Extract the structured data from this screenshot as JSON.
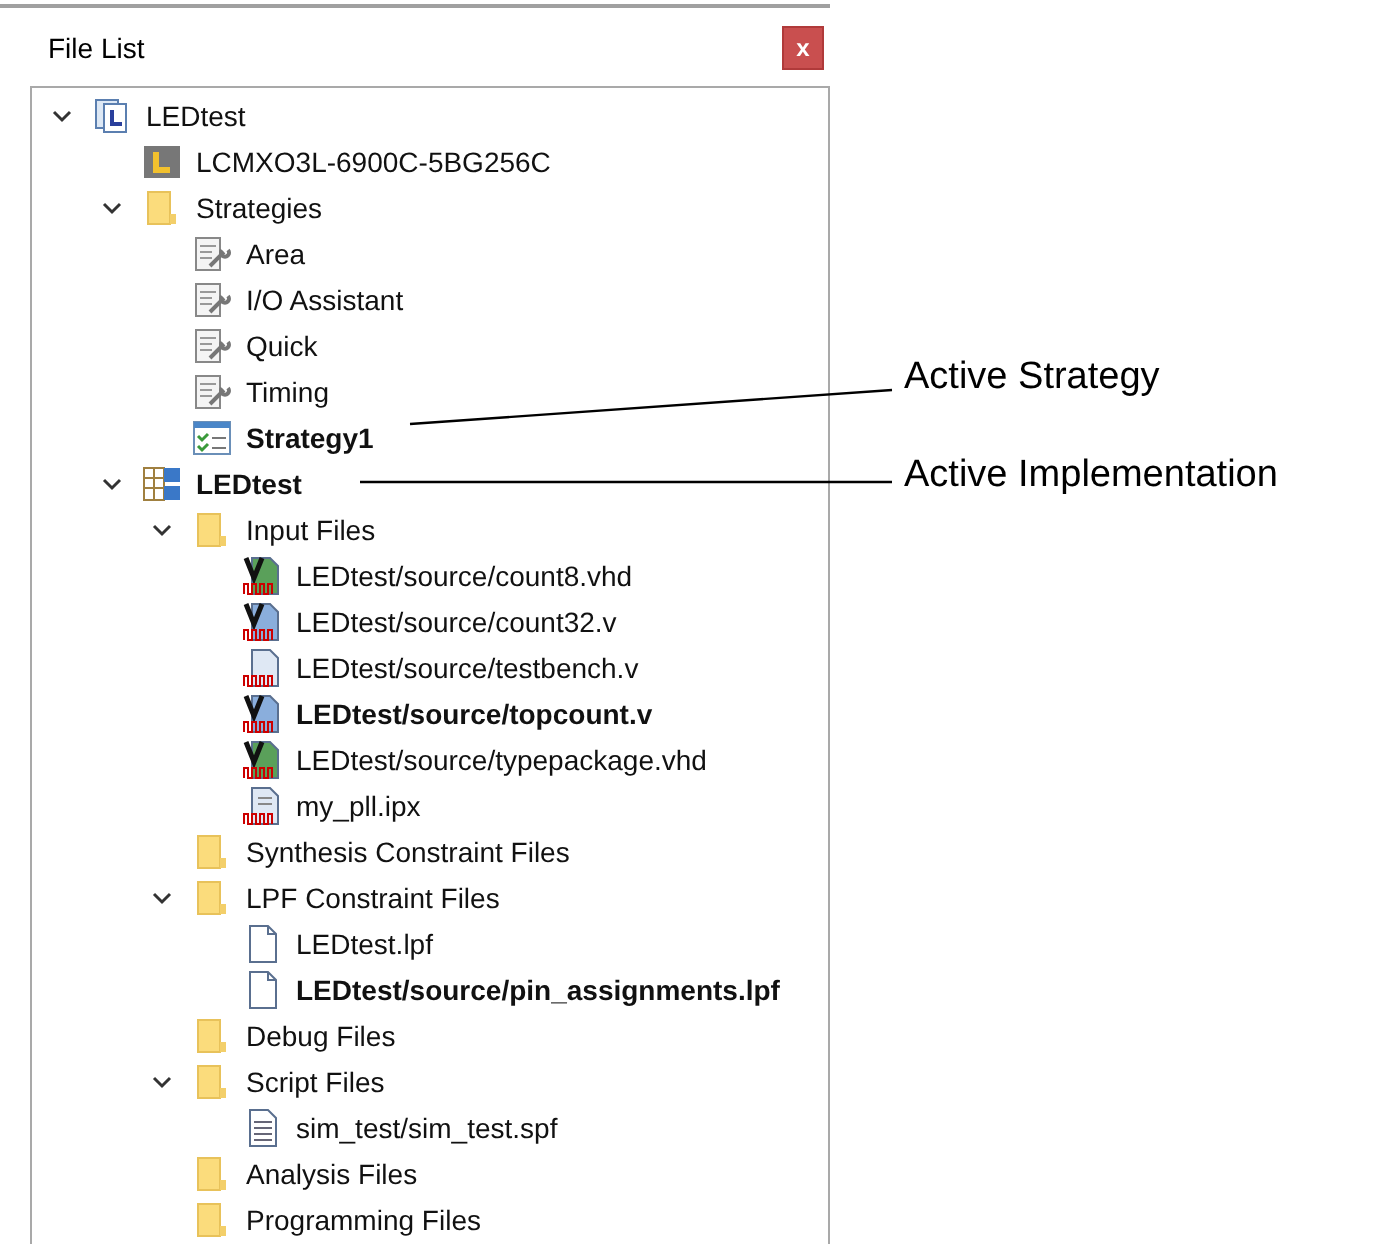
{
  "panel": {
    "title": "File List",
    "close_label": "x"
  },
  "tree": [
    {
      "label": "LEDtest",
      "kind": "project",
      "active": false,
      "expanded": true,
      "children": [
        {
          "label": "LCMXO3L-6900C-5BG256C",
          "kind": "device",
          "active": false
        },
        {
          "label": "Strategies",
          "kind": "folder",
          "active": false,
          "expanded": true,
          "children": [
            {
              "label": "Area",
              "kind": "strategy",
              "active": false
            },
            {
              "label": "I/O Assistant",
              "kind": "strategy",
              "active": false
            },
            {
              "label": "Quick",
              "kind": "strategy",
              "active": false
            },
            {
              "label": "Timing",
              "kind": "strategy",
              "active": false
            },
            {
              "label": "Strategy1",
              "kind": "checklist",
              "active": true
            }
          ]
        },
        {
          "label": "LEDtest",
          "kind": "implementation",
          "active": true,
          "expanded": true,
          "children": [
            {
              "label": "Input Files",
              "kind": "folder",
              "active": false,
              "expanded": true,
              "children": [
                {
                  "label": "LEDtest/source/count8.vhd",
                  "kind": "vhdl",
                  "active": false
                },
                {
                  "label": "LEDtest/source/count32.v",
                  "kind": "verilog",
                  "active": false
                },
                {
                  "label": "LEDtest/source/testbench.v",
                  "kind": "testbench",
                  "active": false
                },
                {
                  "label": "LEDtest/source/topcount.v",
                  "kind": "verilog",
                  "active": true
                },
                {
                  "label": "LEDtest/source/typepackage.vhd",
                  "kind": "vhdl",
                  "active": false
                },
                {
                  "label": "my_pll.ipx",
                  "kind": "ipx",
                  "active": false
                }
              ]
            },
            {
              "label": "Synthesis Constraint Files",
              "kind": "folder",
              "active": false
            },
            {
              "label": "LPF Constraint Files",
              "kind": "folder",
              "active": false,
              "expanded": true,
              "children": [
                {
                  "label": "LEDtest.lpf",
                  "kind": "file",
                  "active": false
                },
                {
                  "label": "LEDtest/source/pin_assignments.lpf",
                  "kind": "file",
                  "active": true
                }
              ]
            },
            {
              "label": "Debug Files",
              "kind": "folder",
              "active": false
            },
            {
              "label": "Script Files",
              "kind": "folder",
              "active": false,
              "expanded": true,
              "children": [
                {
                  "label": "sim_test/sim_test.spf",
                  "kind": "script",
                  "active": false
                }
              ]
            },
            {
              "label": "Analysis Files",
              "kind": "folder",
              "active": false
            },
            {
              "label": "Programming Files",
              "kind": "folder",
              "active": false
            }
          ]
        }
      ]
    }
  ],
  "annotations": [
    {
      "label": "Active Strategy"
    },
    {
      "label": "Active Implementation"
    }
  ]
}
